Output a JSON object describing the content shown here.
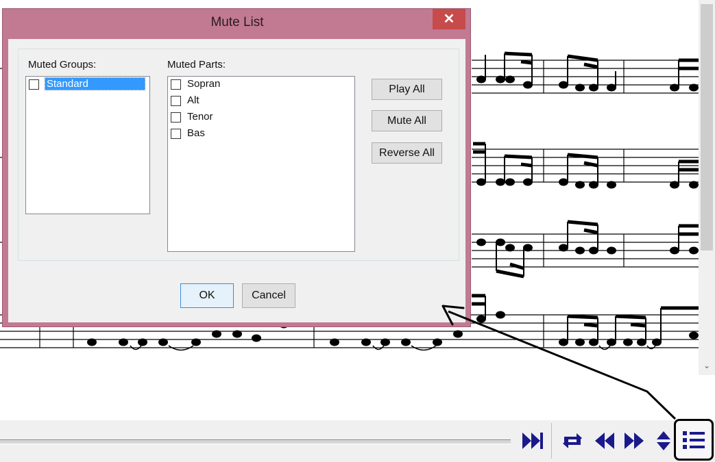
{
  "dialog": {
    "title": "Mute List",
    "close_icon": "close-icon",
    "muted_groups_label": "Muted Groups:",
    "muted_groups": [
      {
        "label": "Standard",
        "checked": false,
        "selected": true
      }
    ],
    "muted_parts_label": "Muted Parts:",
    "muted_parts": [
      {
        "label": "Sopran",
        "checked": false
      },
      {
        "label": "Alt",
        "checked": false
      },
      {
        "label": "Tenor",
        "checked": false
      },
      {
        "label": "Bas",
        "checked": false
      }
    ],
    "buttons": {
      "play_all": "Play All",
      "mute_all": "Mute All",
      "reverse_all": "Reverse All",
      "ok": "OK",
      "cancel": "Cancel"
    }
  },
  "player_bar": {
    "icons": [
      "skip-to-end-icon",
      "repeat-icon",
      "rewind-icon",
      "fast-forward-icon",
      "up-down-icon",
      "list-icon"
    ],
    "accent_color": "#1a1a8c"
  },
  "colors": {
    "dialog_frame": "#c27a93",
    "close_button": "#c74b4b",
    "selection": "#3399ff"
  }
}
